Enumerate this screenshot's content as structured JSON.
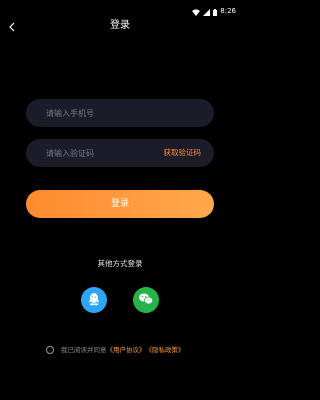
{
  "status_bar": {
    "time": "8:26"
  },
  "header": {
    "title": "登录"
  },
  "form": {
    "phone_placeholder": "请输入手机号",
    "code_placeholder": "请输入验证码",
    "get_code_label": "获取验证码",
    "login_label": "登录"
  },
  "other_login": {
    "label": "其他方式登录",
    "options": [
      {
        "icon": "qq-icon",
        "color": "#2fa6f5"
      },
      {
        "icon": "wechat-icon",
        "color": "#25b34a"
      }
    ]
  },
  "agreement": {
    "prefix": "我已阅读并同意",
    "user_agreement": "《用户协议》",
    "privacy_policy": "《隐私政策》"
  },
  "colors": {
    "background": "#000000",
    "input_background": "#1b1b29",
    "accent": "#ff8a2e",
    "link": "#ff9a3a"
  }
}
